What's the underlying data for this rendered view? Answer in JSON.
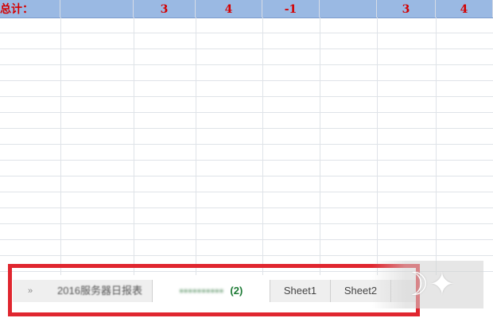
{
  "sheet": {
    "total_label": "总计：",
    "total_values": [
      "",
      "3",
      "4",
      "-1",
      "",
      "3",
      "4"
    ]
  },
  "tabs": {
    "nav_arrow": "»",
    "items": [
      {
        "label": "2016服务器日报表",
        "active": false
      },
      {
        "label": "▪▪▪▪▪▪▪▪▪▪",
        "suffix": "(2)",
        "active": true
      },
      {
        "label": "Sheet1",
        "active": false
      },
      {
        "label": "Sheet2",
        "active": false
      }
    ]
  },
  "colors": {
    "total_row_bg": "#9ab9e3",
    "total_text": "#d40000",
    "highlight_border": "#e0262f",
    "active_tab_text": "#1e7b36"
  },
  "watermark_icon": "logo-watermark"
}
